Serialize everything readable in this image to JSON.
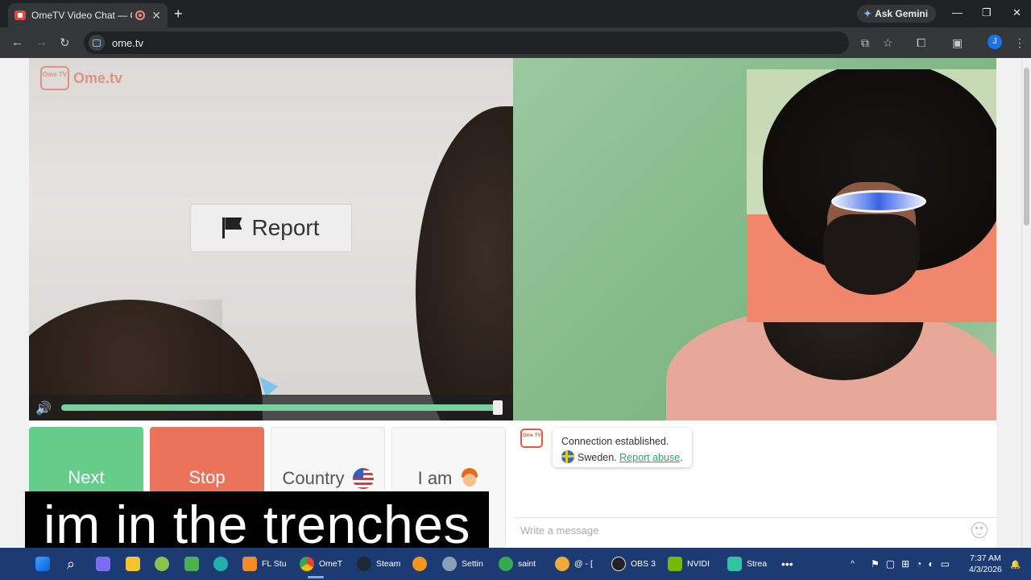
{
  "browser": {
    "tab_title": "OmeTV Video Chat — Ome",
    "new_tab": "+",
    "ask_gemini": "Ask Gemini",
    "url": "ome.tv",
    "profile_initial": "J"
  },
  "page": {
    "logo_badge": "Ome TV",
    "logo_text": "Ome.tv",
    "report_label": "Report",
    "volume_level": 1.0,
    "buttons": {
      "next": "Next",
      "stop": "Stop",
      "country": "Country",
      "iam": "I am"
    },
    "chat": {
      "connection_text": "Connection established.",
      "country_text": "Sweden.",
      "report_abuse": "Report abuse",
      "message_placeholder": "Write a message"
    }
  },
  "caption": "im in the trenches",
  "taskbar": {
    "items": [
      "FL Stu",
      "OmeT",
      "Steam",
      "Settin",
      "saint",
      "@ - [",
      "OBS 3",
      "NVIDI",
      "Strea"
    ],
    "time": "7:37 AM",
    "date": "4/3/2026"
  }
}
